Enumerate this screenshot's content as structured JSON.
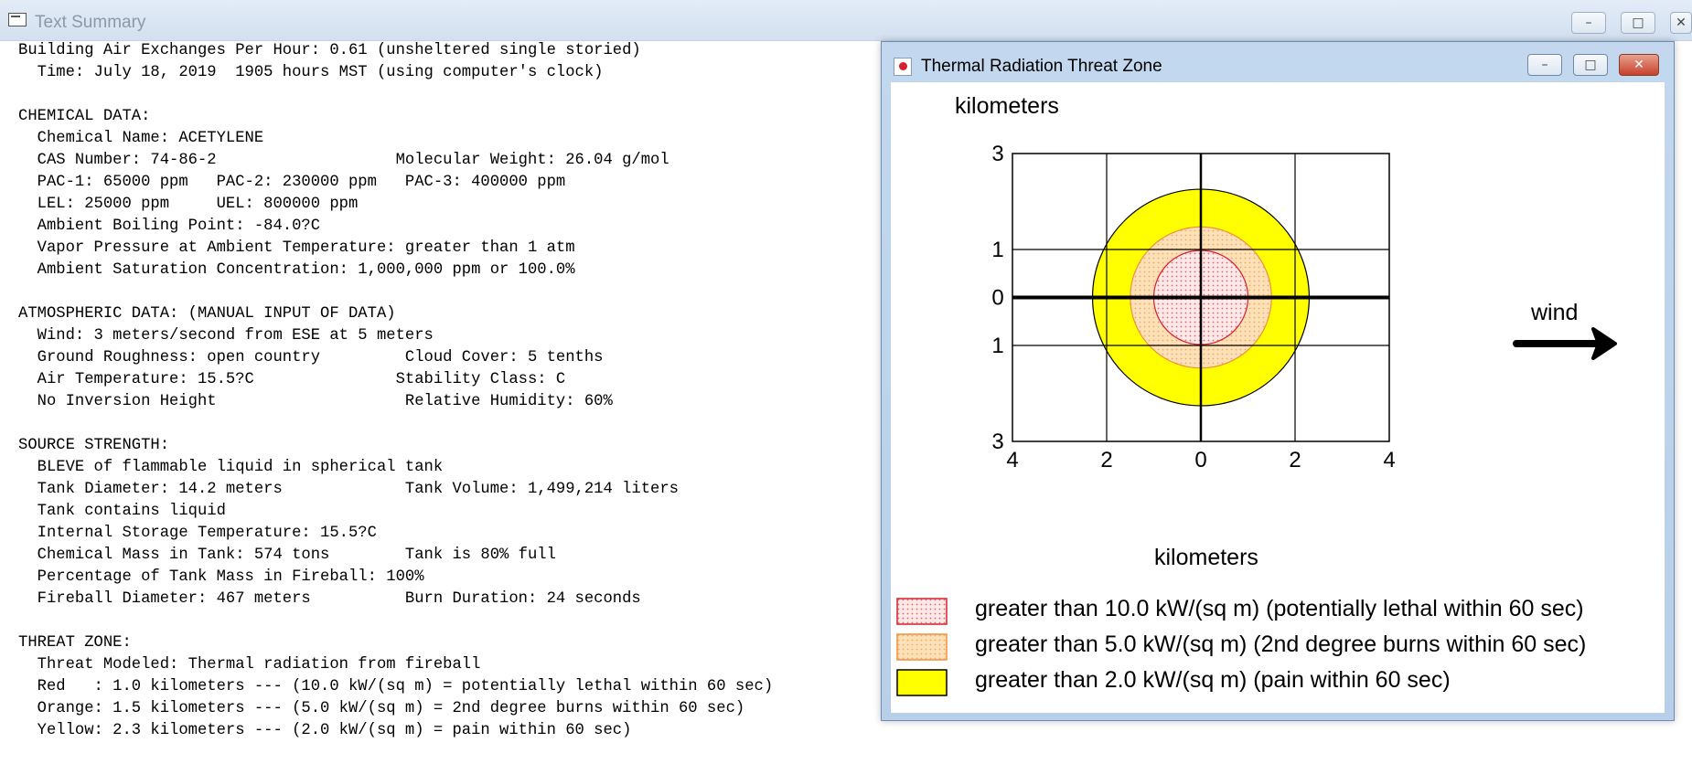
{
  "summary": {
    "title": "Text Summary",
    "text": "Building Air Exchanges Per Hour: 0.61 (unsheltered single storied)\n  Time: July 18, 2019  1905 hours MST (using computer's clock)\n\nCHEMICAL DATA:\n  Chemical Name: ACETYLENE\n  CAS Number: 74-86-2                   Molecular Weight: 26.04 g/mol\n  PAC-1: 65000 ppm   PAC-2: 230000 ppm   PAC-3: 400000 ppm\n  LEL: 25000 ppm     UEL: 800000 ppm\n  Ambient Boiling Point: -84.0?C\n  Vapor Pressure at Ambient Temperature: greater than 1 atm\n  Ambient Saturation Concentration: 1,000,000 ppm or 100.0%\n\nATMOSPHERIC DATA: (MANUAL INPUT OF DATA)\n  Wind: 3 meters/second from ESE at 5 meters\n  Ground Roughness: open country         Cloud Cover: 5 tenths\n  Air Temperature: 15.5?C               Stability Class: C\n  No Inversion Height                    Relative Humidity: 60%\n\nSOURCE STRENGTH:\n  BLEVE of flammable liquid in spherical tank\n  Tank Diameter: 14.2 meters             Tank Volume: 1,499,214 liters\n  Tank contains liquid\n  Internal Storage Temperature: 15.5?C\n  Chemical Mass in Tank: 574 tons        Tank is 80% full\n  Percentage of Tank Mass in Fireball: 100%\n  Fireball Diameter: 467 meters          Burn Duration: 24 seconds\n\nTHREAT ZONE:\n  Threat Modeled: Thermal radiation from fireball\n  Red   : 1.0 kilometers --- (10.0 kW/(sq m) = potentially lethal within 60 sec)\n  Orange: 1.5 kilometers --- (5.0 kW/(sq m) = 2nd degree burns within 60 sec)\n  Yellow: 2.3 kilometers --- (2.0 kW/(sq m) = pain within 60 sec)"
  },
  "caption_buttons": {
    "minimize": "–",
    "maximize": "□",
    "close": "✕"
  },
  "threat_window": {
    "title": "Thermal Radiation Threat Zone",
    "wind_label": "wind",
    "legend": [
      {
        "text": "greater than 10.0 kW/(sq m) (potentially lethal within 60 sec)",
        "fill": "#ffe8e8",
        "dot": "#e7636b",
        "border": "#d81e2c"
      },
      {
        "text": "greater than 5.0 kW/(sq m) (2nd degree burns within 60 sec)",
        "fill": "#ffe1b8",
        "dot": "#f3a66a",
        "border": "#f08f3c"
      },
      {
        "text": "greater than 2.0 kW/(sq m) (pain within 60 sec)",
        "fill": "#ffff00",
        "dot": "",
        "border": "#000000"
      }
    ]
  },
  "chart_data": {
    "type": "threat-zone",
    "ylabel": "kilometers",
    "xlabel": "kilometers",
    "x_ticks": [
      "4",
      "2",
      "0",
      "2",
      "4"
    ],
    "y_ticks": [
      "3",
      "1",
      "0",
      "1",
      "3"
    ],
    "x_tick_values": [
      -4,
      -2,
      0,
      2,
      4
    ],
    "y_tick_values": [
      3,
      1,
      0,
      -1,
      -3
    ],
    "xlim": [
      -4,
      4
    ],
    "ylim": [
      -3,
      3
    ],
    "zones": [
      {
        "name": "Yellow",
        "radius_km": 2.3,
        "color": "#ffff00"
      },
      {
        "name": "Orange",
        "radius_km": 1.5,
        "color": "#ffe1b8"
      },
      {
        "name": "Red",
        "radius_km": 1.0,
        "color": "#ffe8e8"
      }
    ],
    "wind_direction": "east"
  }
}
